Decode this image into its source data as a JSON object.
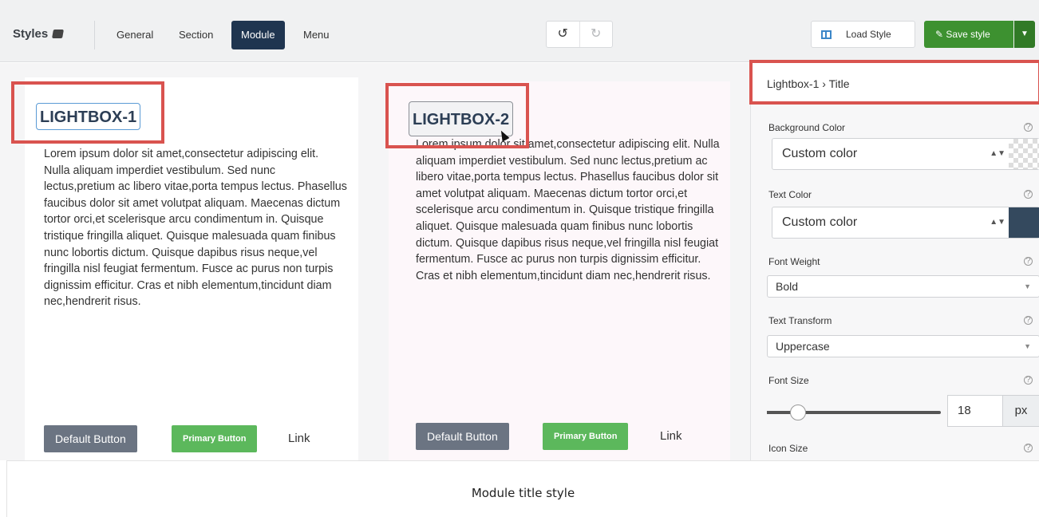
{
  "toolbar": {
    "brand": "Styles",
    "tabs": [
      {
        "label": "General",
        "active": false
      },
      {
        "label": "Section",
        "active": false
      },
      {
        "label": "Module",
        "active": true
      },
      {
        "label": "Menu",
        "active": false
      }
    ],
    "undo_icon": "undo-icon",
    "redo_icon": "redo-icon",
    "load_style_label": "Load Style",
    "save_style_label": "Save style"
  },
  "cards": [
    {
      "title": "LIGHTBOX-1",
      "body": "Lorem ipsum dolor sit amet,consectetur adipiscing elit. Nulla aliquam imperdiet vestibulum. Sed nunc lectus,pretium ac libero vitae,porta tempus lectus. Phasellus faucibus dolor sit amet volutpat aliquam. Maecenas dictum tortor orci,et scelerisque arcu condimentum in. Quisque tristique fringilla aliquet. Quisque malesuada quam finibus nunc lobortis dictum. Quisque dapibus risus neque,vel fringilla nisl feugiat fermentum. Fusce ac purus non turpis dignissim efficitur. Cras et nibh elementum,tincidunt diam nec,hendrerit risus.",
      "default_button": "Default Button",
      "primary_button": "Primary Button",
      "link": "Link"
    },
    {
      "title": "LIGHTBOX-2",
      "body": "Lorem ipsum dolor sit amet,consectetur adipiscing elit. Nulla aliquam imperdiet vestibulum. Sed nunc lectus,pretium ac libero vitae,porta tempus lectus. Phasellus faucibus dolor sit amet volutpat aliquam. Maecenas dictum tortor orci,et scelerisque arcu condimentum in. Quisque tristique fringilla aliquet. Quisque malesuada quam finibus nunc lobortis dictum. Quisque dapibus risus neque,vel fringilla nisl feugiat fermentum. Fusce ac purus non turpis dignissim efficitur. Cras et nibh elementum,tincidunt diam nec,hendrerit risus.",
      "default_button": "Default Button",
      "primary_button": "Primary Button",
      "link": "Link"
    }
  ],
  "panel": {
    "breadcrumb": "Lightbox-1 › Title",
    "background_color_label": "Background Color",
    "background_color_value": "Custom color",
    "text_color_label": "Text Color",
    "text_color_value": "Custom color",
    "text_color_swatch": "#34495e",
    "font_weight_label": "Font Weight",
    "font_weight_value": "Bold",
    "text_transform_label": "Text Transform",
    "text_transform_value": "Uppercase",
    "font_size_label": "Font Size",
    "font_size_value": "18",
    "font_size_slider_fraction": 0.18,
    "font_size_unit": "px",
    "icon_size_label": "Icon Size"
  },
  "caption": "Module title style",
  "colors": {
    "active_tab": "#1f3550",
    "save_green": "#3d9130",
    "highlight_red": "#d9534f",
    "primary_green": "#5cb85c",
    "default_gray": "#6b7482"
  }
}
